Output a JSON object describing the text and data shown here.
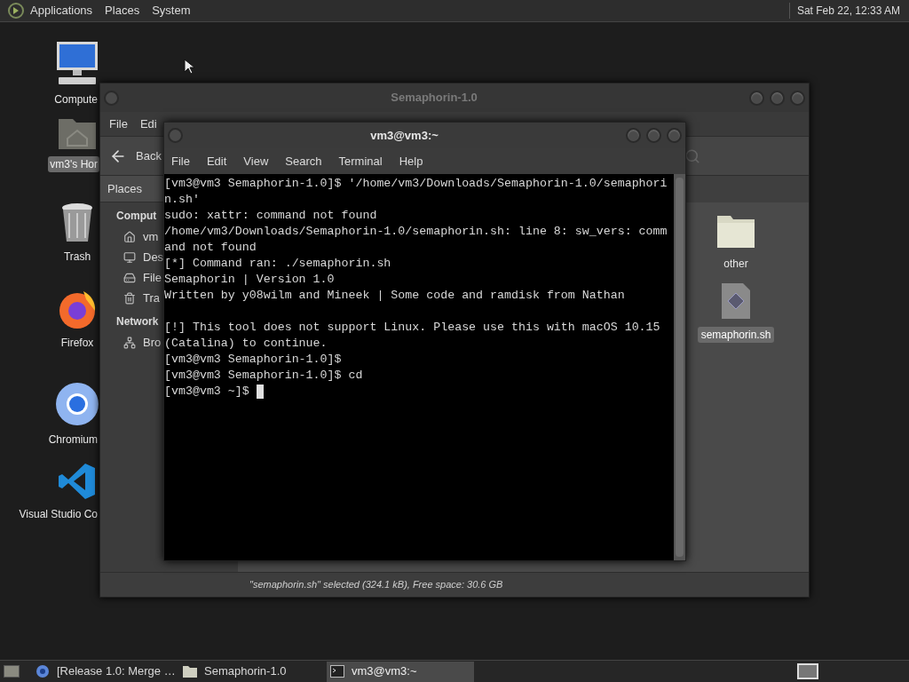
{
  "top_panel": {
    "menus": [
      "Applications",
      "Places",
      "System"
    ],
    "clock": "Sat Feb 22, 12:33 AM"
  },
  "desktop_icons": [
    {
      "kind": "computer",
      "label": "Compute",
      "selected": false
    },
    {
      "kind": "home",
      "label": "vm3's Hor",
      "selected": true
    },
    {
      "kind": "trash",
      "label": "Trash",
      "selected": false
    },
    {
      "kind": "firefox",
      "label": "Firefox",
      "selected": false
    },
    {
      "kind": "chromium",
      "label": "Chromium",
      "selected": false
    },
    {
      "kind": "vscode",
      "label": "Visual Studio Co",
      "selected": false
    }
  ],
  "file_manager": {
    "title": "Semaphorin-1.0",
    "menus": [
      "File",
      "Edi"
    ],
    "back": "Back",
    "sidebar": {
      "title": "Places",
      "sections": [
        {
          "heading": "Comput",
          "items": [
            {
              "kind": "home",
              "label": "vm"
            },
            {
              "kind": "desktop",
              "label": "Des"
            },
            {
              "kind": "drive",
              "label": "File"
            },
            {
              "kind": "trash",
              "label": "Tra"
            }
          ]
        },
        {
          "heading": "Network",
          "items": [
            {
              "kind": "network",
              "label": "Bro"
            }
          ]
        }
      ]
    },
    "files": [
      {
        "kind": "folder",
        "name": "other",
        "selected": false
      },
      {
        "kind": "script",
        "name": "semaphorin.sh",
        "selected": true
      }
    ],
    "status": "\"semaphorin.sh\" selected (324.1 kB), Free space: 30.6 GB"
  },
  "terminal": {
    "title": "vm3@vm3:~",
    "menus": [
      "File",
      "Edit",
      "View",
      "Search",
      "Terminal",
      "Help"
    ],
    "blocks": [
      [
        "[vm3@vm3 Semaphorin-1.0]$ '/home/vm3/Downloads/Semaphorin-1.0/semaphori",
        "n.sh'",
        "sudo: xattr: command not found",
        "/home/vm3/Downloads/Semaphorin-1.0/semaphorin.sh: line 8: sw_vers: comm",
        "and not found",
        "[*] Command ran: ./semaphorin.sh",
        "Semaphorin | Version 1.0",
        "Written by y08wilm and Mineek | Some code and ramdisk from Nathan"
      ],
      [
        "[!] This tool does not support Linux. Please use this with macOS 10.15",
        "(Catalina) to continue.",
        "[vm3@vm3 Semaphorin-1.0]$",
        "[vm3@vm3 Semaphorin-1.0]$ cd",
        "[vm3@vm3 ~]$"
      ]
    ]
  },
  "taskbar": {
    "tasks": [
      {
        "kind": "browser",
        "label": "[Release 1.0: Merge …",
        "selected": false
      },
      {
        "kind": "folder",
        "label": "Semaphorin-1.0",
        "selected": false
      },
      {
        "kind": "terminal",
        "label": "vm3@vm3:~",
        "selected": true
      }
    ]
  }
}
